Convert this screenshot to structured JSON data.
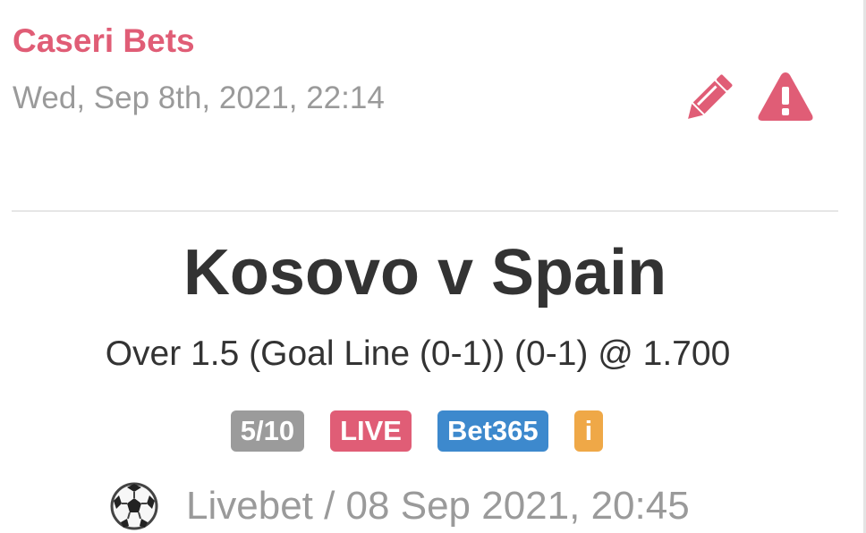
{
  "post": {
    "author": "Caseri Bets",
    "timestamp": "Wed, Sep 8th, 2021, 22:14",
    "actions": {
      "edit_icon": "pencil-icon",
      "report_icon": "warning-triangle-icon"
    }
  },
  "bet": {
    "match": "Kosovo v Spain",
    "selection": "Over 1.5 (Goal Line (0-1)) (0-1) @ 1.700",
    "badges": {
      "rating": "5/10",
      "live": "LIVE",
      "bookmaker": "Bet365",
      "info": "i"
    },
    "sport_icon": "soccer-ball-icon",
    "footer": "Livebet / 08 Sep 2021, 20:45"
  },
  "colors": {
    "accent": "#e05d76",
    "muted_text": "#9a9a9a",
    "title_text": "#333333",
    "rating_badge": "#9b9b9b",
    "bookmaker_badge": "#3d89cd",
    "info_badge": "#efa847"
  }
}
